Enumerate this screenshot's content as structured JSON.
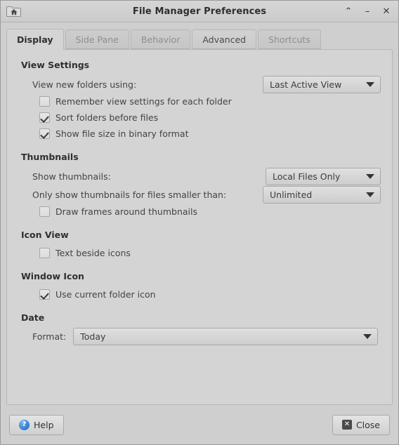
{
  "window": {
    "title": "File Manager Preferences",
    "icon": "home-folder-icon",
    "controls": {
      "shade_label": "⌃",
      "minimize_label": "–",
      "close_label": "✕"
    }
  },
  "tabs": [
    {
      "label": "Display",
      "state": "active"
    },
    {
      "label": "Side Pane",
      "state": "normal"
    },
    {
      "label": "Behavior",
      "state": "normal"
    },
    {
      "label": "Advanced",
      "state": "hover"
    },
    {
      "label": "Shortcuts",
      "state": "normal"
    }
  ],
  "display": {
    "view_settings": {
      "title": "View Settings",
      "view_new_folders_label": "View new folders using:",
      "view_new_folders_value": "Last Active View",
      "remember_view_label": "Remember view settings for each folder",
      "remember_view_checked": false,
      "sort_folders_label": "Sort folders before files",
      "sort_folders_checked": true,
      "binary_format_label": "Show file size in binary format",
      "binary_format_checked": true
    },
    "thumbnails": {
      "title": "Thumbnails",
      "show_thumbnails_label": "Show thumbnails:",
      "show_thumbnails_value": "Local Files Only",
      "size_limit_label": "Only show thumbnails for files smaller than:",
      "size_limit_value": "Unlimited",
      "draw_frames_label": "Draw frames around thumbnails",
      "draw_frames_checked": false
    },
    "icon_view": {
      "title": "Icon View",
      "text_beside_icons_label": "Text beside icons",
      "text_beside_icons_checked": false
    },
    "window_icon": {
      "title": "Window Icon",
      "use_folder_icon_label": "Use current folder icon",
      "use_folder_icon_checked": true
    },
    "date": {
      "title": "Date",
      "format_label": "Format:",
      "format_value": "Today"
    }
  },
  "actions": {
    "help_label": "Help",
    "help_icon_glyph": "?",
    "close_label": "Close",
    "close_icon_glyph": "✕"
  }
}
